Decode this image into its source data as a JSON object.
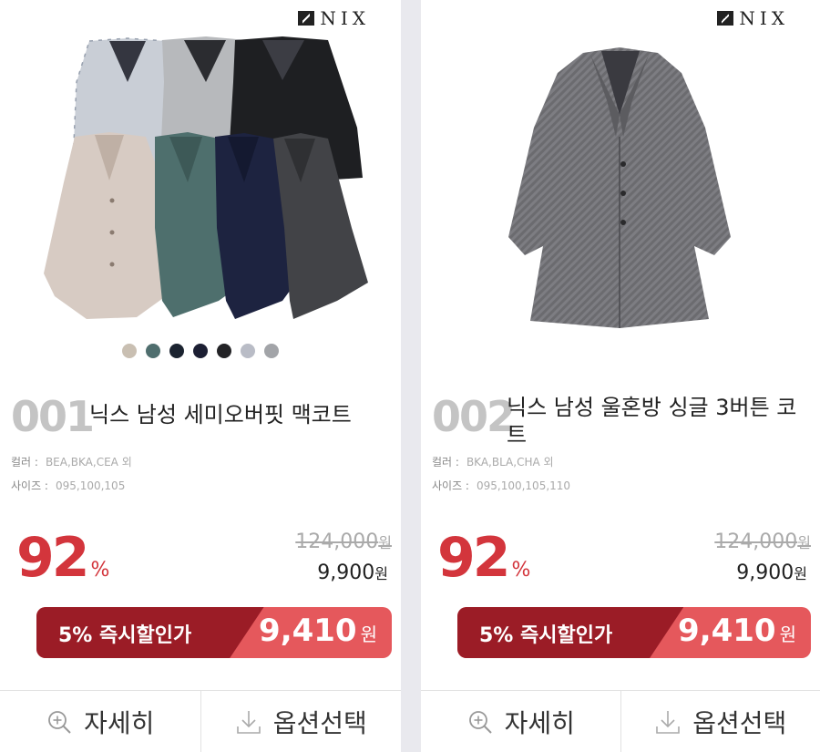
{
  "brand": "NIX",
  "products": [
    {
      "number": "001",
      "title": "닉스 남성 세미오버핏 맥코트",
      "color_label": "컬러 :",
      "colors": "BEA,BKA,CEA 외",
      "size_label": "사이즈 :",
      "sizes": "095,100,105",
      "discount": "92",
      "discount_unit": "%",
      "original_price": "124,000",
      "price": "9,900",
      "currency": "원",
      "instant_label": "5% 즉시할인가",
      "instant_price": "9,410",
      "swatches": [
        "#c9bfb2",
        "#4f6e6e",
        "#1b2330",
        "#1c1f33",
        "#232326",
        "#b9bcc6",
        "#a2a4a8"
      ],
      "detail_label": "자세히",
      "option_label": "옵션선택"
    },
    {
      "number": "002",
      "title": "닉스 남성 울혼방 싱글 3버튼 코트",
      "color_label": "컬러 :",
      "colors": "BKA,BLA,CHA 외",
      "size_label": "사이즈 :",
      "sizes": "095,100,105,110",
      "discount": "92",
      "discount_unit": "%",
      "original_price": "124,000",
      "price": "9,900",
      "currency": "원",
      "instant_label": "5% 즉시할인가",
      "instant_price": "9,410",
      "detail_label": "자세히",
      "option_label": "옵션선택"
    }
  ],
  "icons": [
    "zoom-in-icon",
    "download-icon"
  ]
}
